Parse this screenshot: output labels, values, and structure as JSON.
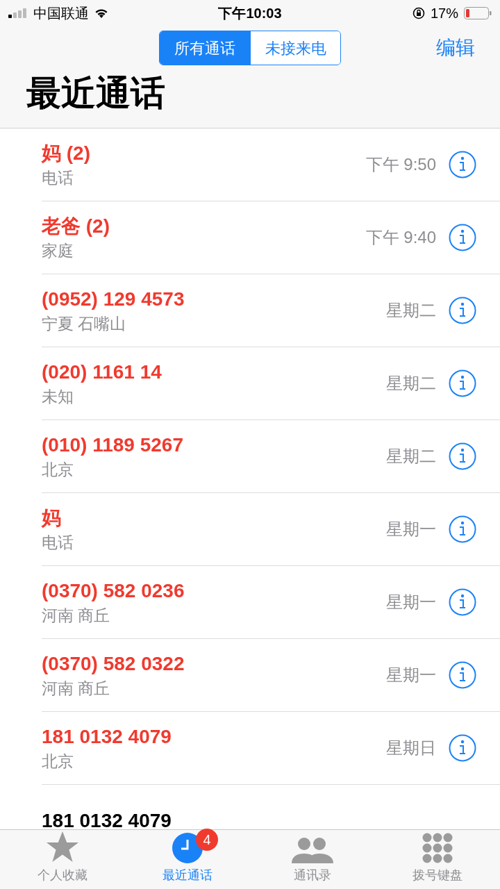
{
  "status_bar": {
    "carrier": "中国联通",
    "time": "下午10:03",
    "battery": "17%"
  },
  "segments": [
    {
      "label": "所有通话",
      "selected": true
    },
    {
      "label": "未接来电",
      "selected": false
    }
  ],
  "edit_button": "编辑",
  "title": "最近通话",
  "calls": [
    {
      "name": "妈 (2)",
      "subtitle": "电话",
      "time": "下午 9:50",
      "missed": true
    },
    {
      "name": "老爸 (2)",
      "subtitle": "家庭",
      "time": "下午 9:40",
      "missed": true
    },
    {
      "name": "(0952) 129 4573",
      "subtitle": "宁夏 石嘴山",
      "time": "星期二",
      "missed": true
    },
    {
      "name": "(020) 1161 14",
      "subtitle": "未知",
      "time": "星期二",
      "missed": true
    },
    {
      "name": "(010) 1189 5267",
      "subtitle": "北京",
      "time": "星期二",
      "missed": true
    },
    {
      "name": "妈",
      "subtitle": "电话",
      "time": "星期一",
      "missed": true
    },
    {
      "name": "(0370) 582 0236",
      "subtitle": "河南 商丘",
      "time": "星期一",
      "missed": true
    },
    {
      "name": "(0370) 582 0322",
      "subtitle": "河南 商丘",
      "time": "星期一",
      "missed": true
    },
    {
      "name": "181 0132 4079",
      "subtitle": "北京",
      "time": "星期日",
      "missed": true
    },
    {
      "name": "181 0132 4079",
      "missed": false
    }
  ],
  "tab_bar": [
    {
      "kind": "star",
      "label": "个人收藏",
      "selected": false
    },
    {
      "kind": "clock",
      "label": "最近通话",
      "selected": true,
      "badge": "4"
    },
    {
      "kind": "people",
      "label": "通讯录",
      "selected": false
    },
    {
      "kind": "keypad",
      "label": "拨号键盘",
      "selected": false
    }
  ]
}
